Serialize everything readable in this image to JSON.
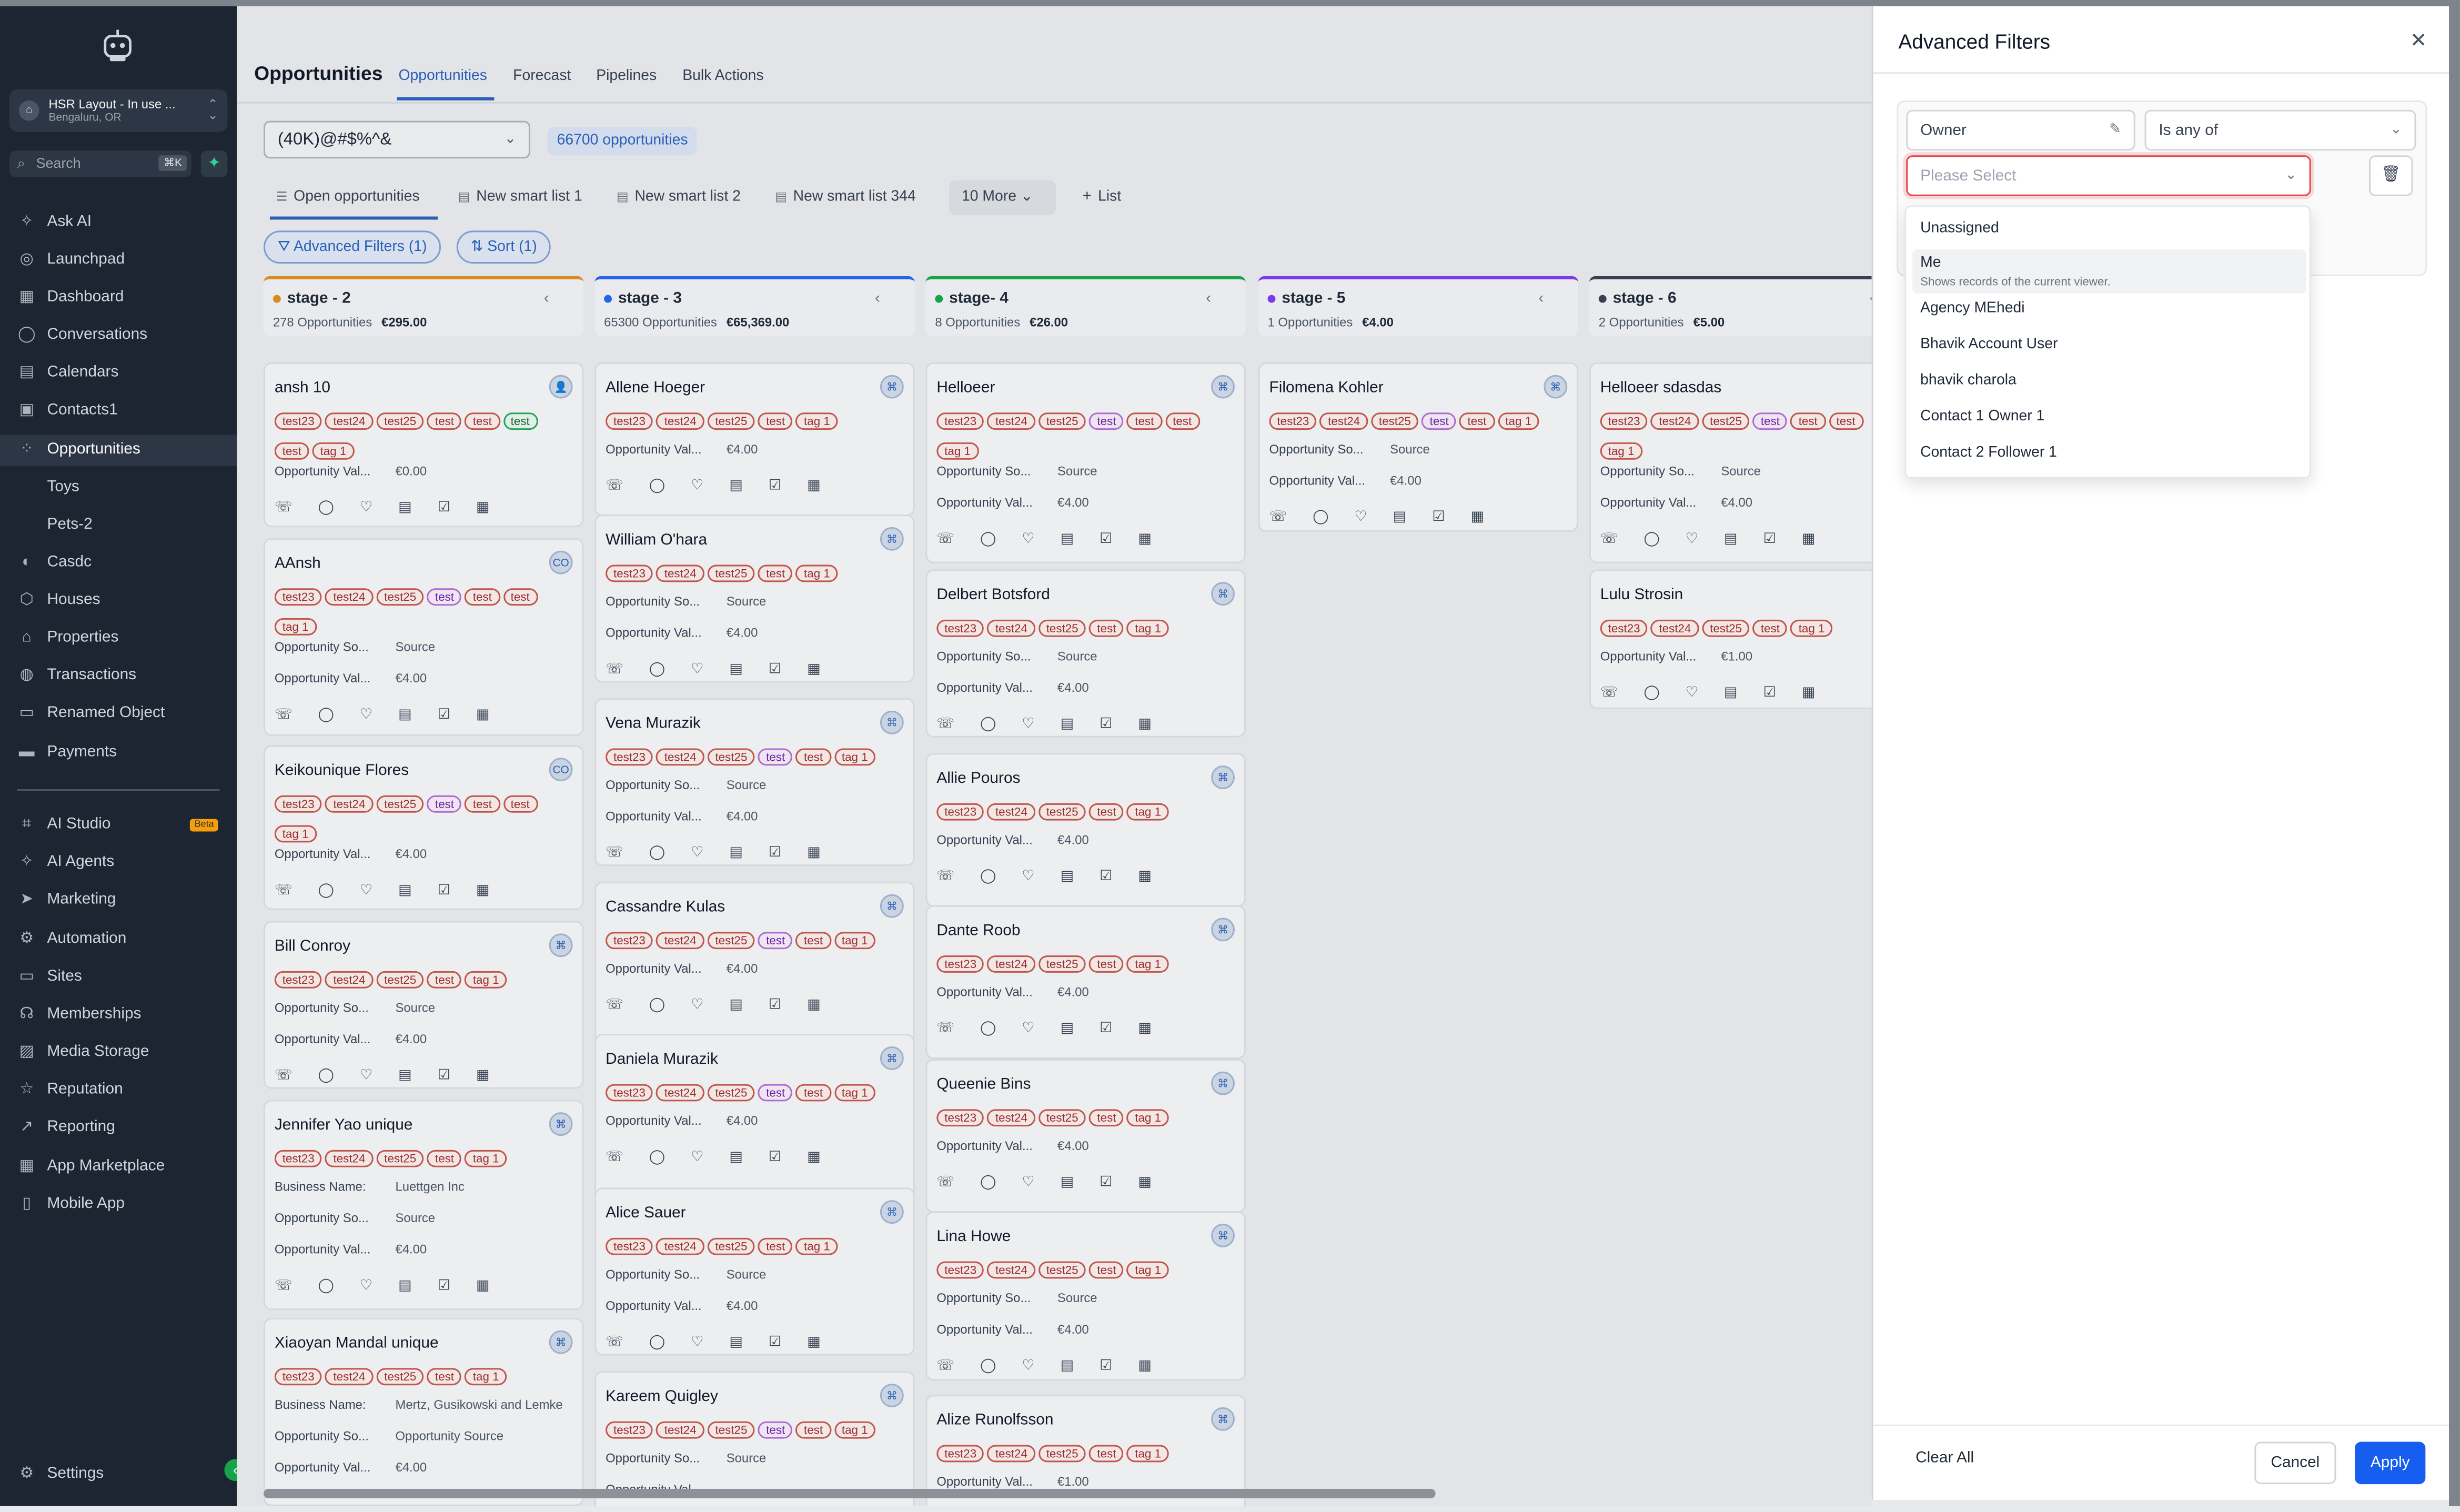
{
  "sidebar": {
    "location": {
      "avatar": "⌂",
      "name": "HSR Layout - In use ...",
      "city": "Bengaluru, OR"
    },
    "search": {
      "placeholder": "Search",
      "shortcut": "⌘K"
    },
    "items": [
      {
        "label": "Ask AI",
        "icon": "✧"
      },
      {
        "label": "Launchpad",
        "icon": "◎"
      },
      {
        "label": "Dashboard",
        "icon": "▦"
      },
      {
        "label": "Conversations",
        "icon": "◯"
      },
      {
        "label": "Calendars",
        "icon": "▤"
      },
      {
        "label": "Contacts1",
        "icon": "▣"
      },
      {
        "label": "Opportunities",
        "icon": "⁘"
      },
      {
        "label": "Toys",
        "icon": ""
      },
      {
        "label": "Pets-2",
        "icon": ""
      },
      {
        "label": "Casdc",
        "icon": "◐"
      },
      {
        "label": "Houses",
        "icon": "⬡"
      },
      {
        "label": "Properties",
        "icon": "⌂"
      },
      {
        "label": "Transactions",
        "icon": "◍"
      },
      {
        "label": "Renamed Object",
        "icon": "▭"
      },
      {
        "label": "Payments",
        "icon": "▬"
      }
    ],
    "items2": [
      {
        "label": "AI Studio",
        "icon": "⌗",
        "badge": "Beta"
      },
      {
        "label": "AI Agents",
        "icon": "✧"
      },
      {
        "label": "Marketing",
        "icon": "➤"
      },
      {
        "label": "Automation",
        "icon": "⚙"
      },
      {
        "label": "Sites",
        "icon": "▭"
      },
      {
        "label": "Memberships",
        "icon": "☊"
      },
      {
        "label": "Media Storage",
        "icon": "▨"
      },
      {
        "label": "Reputation",
        "icon": "☆"
      },
      {
        "label": "Reporting",
        "icon": "↗"
      },
      {
        "label": "App Marketplace",
        "icon": "▦"
      },
      {
        "label": "Mobile App",
        "icon": "▯"
      }
    ],
    "settings": "Settings"
  },
  "header": {
    "title": "Opportunities",
    "tabs": [
      "Opportunities",
      "Forecast",
      "Pipelines",
      "Bulk Actions"
    ]
  },
  "toolbar": {
    "pipeline": "(40K)@#$%^&",
    "count": "66700 opportunities",
    "smart_lists": [
      "Open opportunities",
      "New smart list 1",
      "New smart list 2",
      "New smart list 344"
    ],
    "more": "10 More",
    "add_list": "List",
    "advanced_filters": "Advanced Filters (1)",
    "sort": "Sort (1)"
  },
  "labels": {
    "opp_source": "Opportunity So...",
    "opp_value": "Opportunity Val...",
    "business": "Business Name:",
    "source": "Source",
    "opp_source_value": "Opportunity Source"
  },
  "columns": [
    {
      "name": "stage - 2",
      "count": "278 Opportunities",
      "total": "€295.00",
      "color": "#d98b1f"
    },
    {
      "name": "stage - 3",
      "count": "65300 Opportunities",
      "total": "€65,369.00",
      "color": "#2563eb"
    },
    {
      "name": "stage- 4",
      "count": "8 Opportunities",
      "total": "€26.00",
      "color": "#16a34a"
    },
    {
      "name": "stage - 5",
      "count": "1 Opportunities",
      "total": "€4.00",
      "color": "#7c3aed"
    },
    {
      "name": "stage - 6",
      "count": "2 Opportunities",
      "total": "€5.00",
      "color": "#374151"
    }
  ],
  "cards": {
    "c0": [
      {
        "name": "ansh 10",
        "value": "€0.00",
        "badge": "👤"
      },
      {
        "name": "AAnsh",
        "value": "€4.00",
        "badge": "CO"
      },
      {
        "name": "Keikounique Flores",
        "value": "€4.00",
        "badge": "CO"
      },
      {
        "name": "Bill Conroy",
        "value": "€4.00",
        "badge": "⌘"
      },
      {
        "name": "Jennifer Yao unique",
        "value": "€4.00",
        "business": "Luettgen Inc",
        "badge": "⌘"
      },
      {
        "name": "Xiaoyan Mandal unique",
        "value": "€4.00",
        "business": "Mertz, Gusikowski and Lemke",
        "badge": "⌘"
      }
    ],
    "c1": [
      {
        "name": "Allene Hoeger",
        "value": "€4.00"
      },
      {
        "name": "William O'hara",
        "value": "€4.00"
      },
      {
        "name": "Vena Murazik",
        "value": "€4.00"
      },
      {
        "name": "Cassandre Kulas",
        "value": "€4.00"
      },
      {
        "name": "Daniela Murazik",
        "value": "€4.00"
      },
      {
        "name": "Alice Sauer",
        "value": "€4.00"
      },
      {
        "name": "Kareem Quigley",
        "value": ""
      }
    ],
    "c2": [
      {
        "name": "Helloeer",
        "value": "€4.00"
      },
      {
        "name": "Delbert Botsford",
        "value": "€4.00"
      },
      {
        "name": "Allie Pouros",
        "value": "€4.00"
      },
      {
        "name": "Dante Roob",
        "value": "€4.00"
      },
      {
        "name": "Queenie Bins",
        "value": "€4.00"
      },
      {
        "name": "Lina Howe",
        "value": "€4.00"
      },
      {
        "name": "Alize Runolfsson",
        "value": "€1.00"
      }
    ],
    "c3": [
      {
        "name": "Filomena Kohler",
        "value": "€4.00"
      }
    ],
    "c4": [
      {
        "name": "Helloeer sdasdas",
        "value": "€4.00"
      },
      {
        "name": "Lulu Strosin",
        "value": "€1.00"
      }
    ]
  },
  "tagset": {
    "a": "test23",
    "b": "test24",
    "c": "test25",
    "d": "test",
    "e": "tag 1"
  },
  "icon_row": "☏ ◯ ♡ ▤ ☑ ▦",
  "drawer": {
    "title": "Advanced Filters",
    "field": "Owner",
    "operator": "Is any of",
    "value_placeholder": "Please Select",
    "options": [
      {
        "label": "Unassigned"
      },
      {
        "label": "Me",
        "hint": "Shows records of the current viewer."
      },
      {
        "label": "Agency MEhedi"
      },
      {
        "label": "Bhavik Account User"
      },
      {
        "label": "bhavik charola"
      },
      {
        "label": "Contact 1 Owner 1"
      },
      {
        "label": "Contact 2 Follower 1"
      }
    ],
    "clear_all": "Clear All",
    "cancel": "Cancel",
    "apply": "Apply"
  }
}
